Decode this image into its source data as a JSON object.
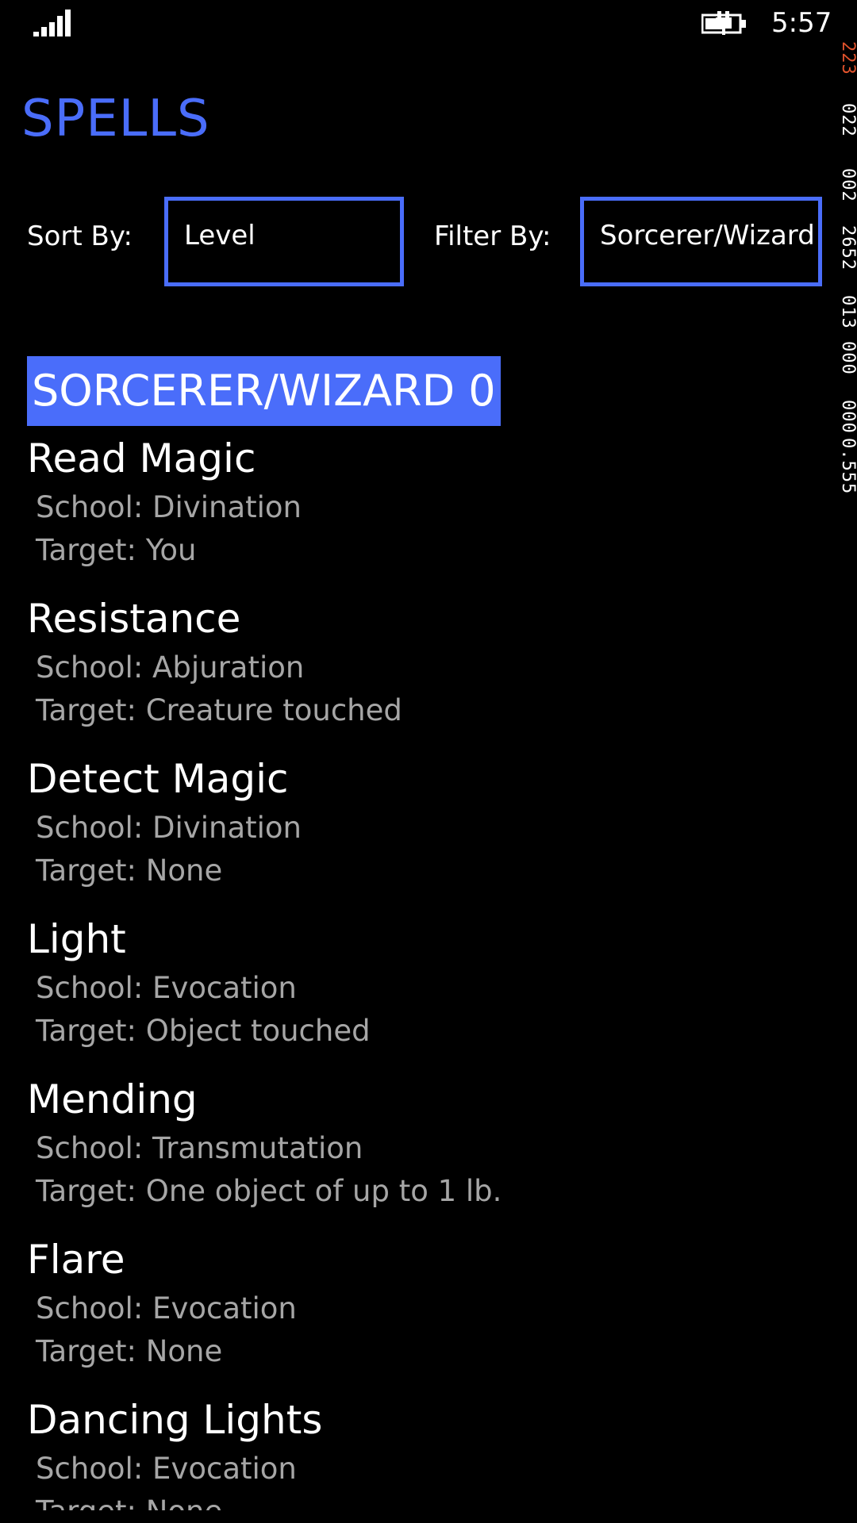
{
  "status": {
    "time": "5:57"
  },
  "debug_counters": [
    "223",
    "022",
    "002",
    "2652",
    "013",
    "000",
    "000",
    "0.555"
  ],
  "page": {
    "title": "SPELLS"
  },
  "controls": {
    "sort_label": "Sort By:",
    "sort_value": "Level",
    "filter_label": "Filter By:",
    "filter_value": "Sorcerer/Wizard"
  },
  "group": {
    "header": "SORCERER/WIZARD 0"
  },
  "spells": [
    {
      "name": "Read Magic",
      "school": "School: Divination",
      "target": "Target: You"
    },
    {
      "name": "Resistance",
      "school": "School: Abjuration",
      "target": "Target: Creature touched"
    },
    {
      "name": "Detect Magic",
      "school": "School: Divination",
      "target": "Target: None"
    },
    {
      "name": "Light",
      "school": "School: Evocation",
      "target": "Target: Object touched"
    },
    {
      "name": "Mending",
      "school": "School: Transmutation",
      "target": "Target: One object of up to 1 lb."
    },
    {
      "name": "Flare",
      "school": "School: Evocation",
      "target": "Target: None"
    },
    {
      "name": "Dancing Lights",
      "school": "School: Evocation",
      "target": "Target: None"
    }
  ],
  "colors": {
    "accent": "#4a6dfa",
    "background": "#000000",
    "secondary_text": "#a6a6a6",
    "fps_counter": "#e0522c"
  }
}
